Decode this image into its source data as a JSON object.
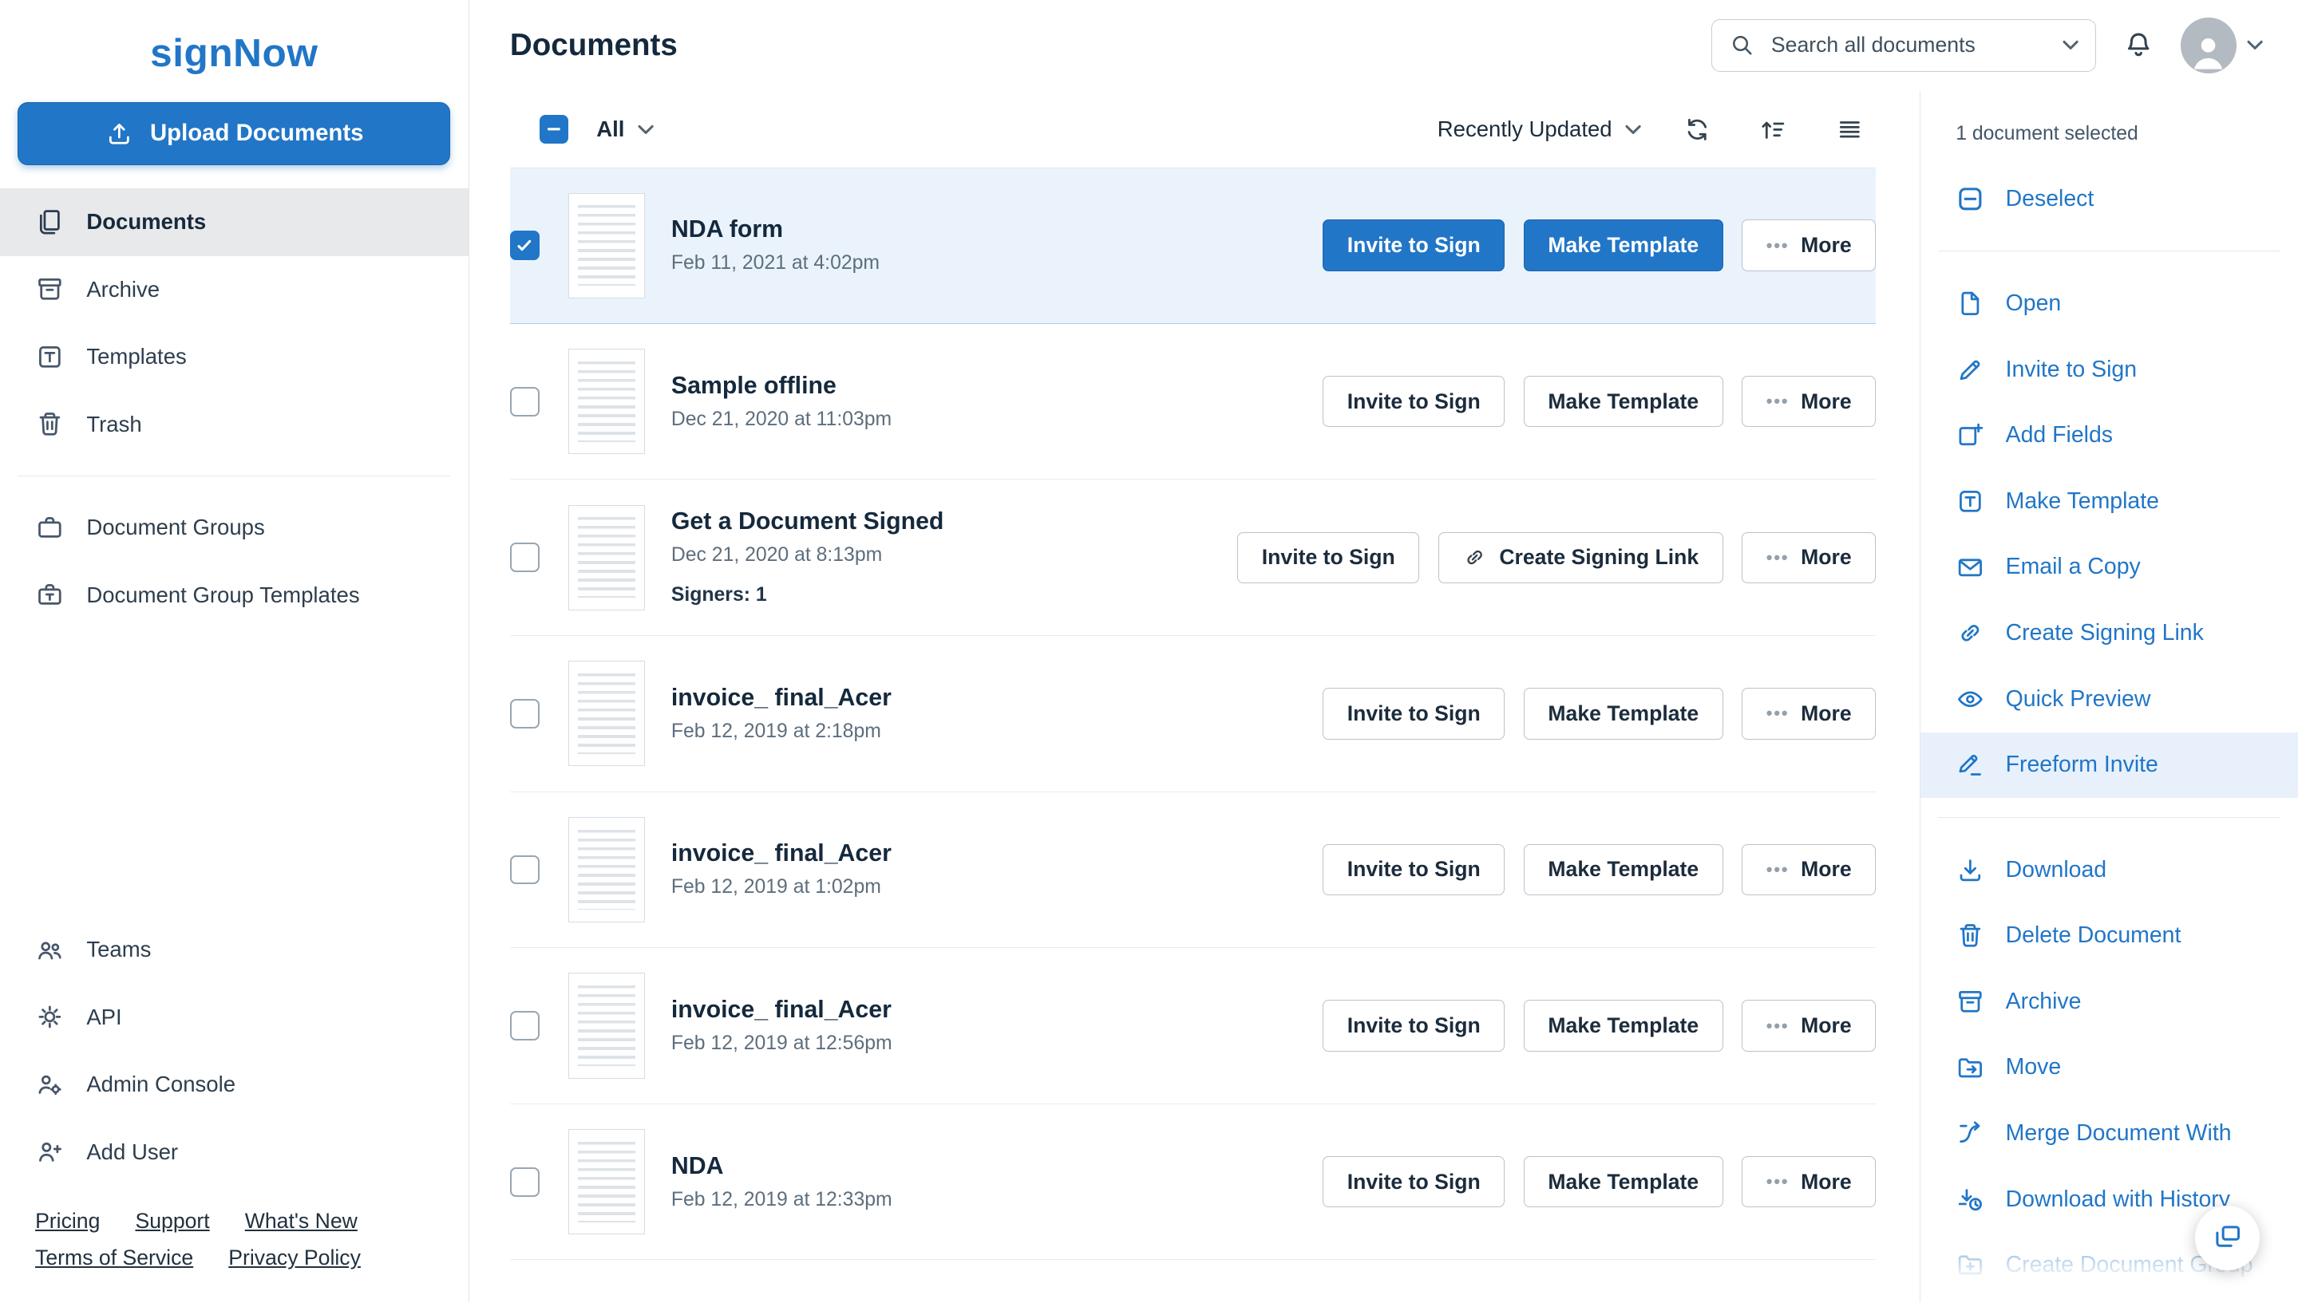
{
  "brand": {
    "logo_text": "signNow"
  },
  "sidebar": {
    "upload_label": "Upload Documents",
    "nav": [
      {
        "label": "Documents"
      },
      {
        "label": "Archive"
      },
      {
        "label": "Templates"
      },
      {
        "label": "Trash"
      }
    ],
    "nav_groups": [
      {
        "label": "Document Groups"
      },
      {
        "label": "Document Group Templates"
      }
    ],
    "nav_bottom": [
      {
        "label": "Teams"
      },
      {
        "label": "API"
      },
      {
        "label": "Admin Console"
      },
      {
        "label": "Add User"
      }
    ],
    "footer_links": [
      "Pricing",
      "Support",
      "What's New",
      "Terms of Service",
      "Privacy Policy"
    ]
  },
  "header": {
    "title": "Documents",
    "search_placeholder": "Search all documents"
  },
  "toolbar": {
    "filter_all": "All",
    "sort_by": "Recently Updated"
  },
  "buttons": {
    "invite": "Invite to Sign",
    "make_template": "Make Template",
    "create_signing_link": "Create Signing Link",
    "more": "More",
    "ellipsis": "•••"
  },
  "documents": [
    {
      "title": "NDA form",
      "date": "Feb 11, 2021 at 4:02pm"
    },
    {
      "title": "Sample offline",
      "date": "Dec 21, 2020 at 11:03pm"
    },
    {
      "title": "Get a Document Signed",
      "date": "Dec 21, 2020 at 8:13pm",
      "signers": "Signers: 1"
    },
    {
      "title": "invoice_ final_Acer",
      "date": "Feb 12, 2019 at 2:18pm"
    },
    {
      "title": "invoice_ final_Acer",
      "date": "Feb 12, 2019 at 1:02pm"
    },
    {
      "title": "invoice_ final_Acer",
      "date": "Feb 12, 2019 at 12:56pm"
    },
    {
      "title": "NDA",
      "date": "Feb 12, 2019 at 12:33pm"
    }
  ],
  "panel": {
    "selected_count": "1 document selected",
    "deselect_label": "Deselect",
    "actions_primary": [
      "Open",
      "Invite to Sign",
      "Add Fields",
      "Make Template",
      "Email a Copy",
      "Create Signing Link",
      "Quick Preview",
      "Freeform Invite"
    ],
    "actions_secondary": [
      "Download",
      "Delete Document",
      "Archive",
      "Move",
      "Merge Document With",
      "Download with History",
      "Create Document Group"
    ]
  },
  "colors": {
    "accent": "#2176c7",
    "selected_row_bg": "#eaf3fc",
    "active_nav_bg": "#e7e9ea"
  }
}
